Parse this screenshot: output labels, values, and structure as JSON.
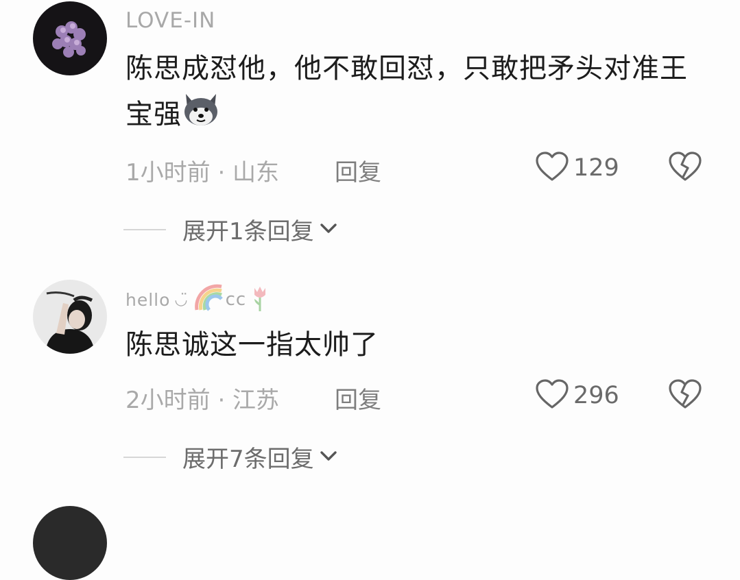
{
  "comments": [
    {
      "username": "LOVE-IN",
      "text": "陈思成怼他，他不敢回怼，只敢把矛头对准王宝强",
      "emoji": "husky-dog-emoji",
      "time_location": "1小时前 · 山东",
      "reply_label": "回复",
      "likes": "129",
      "expand_label": "展开1条回复"
    },
    {
      "username": "hello",
      "username_suffix": "cc",
      "text": "陈思诚这一指太帅了",
      "time_location": "2小时前 · 江苏",
      "reply_label": "回复",
      "likes": "296",
      "expand_label": "展开7条回复"
    }
  ],
  "colors": {
    "background": "#fdfdfd",
    "text": "#1c1c1c",
    "meta": "#a9a9a9"
  }
}
